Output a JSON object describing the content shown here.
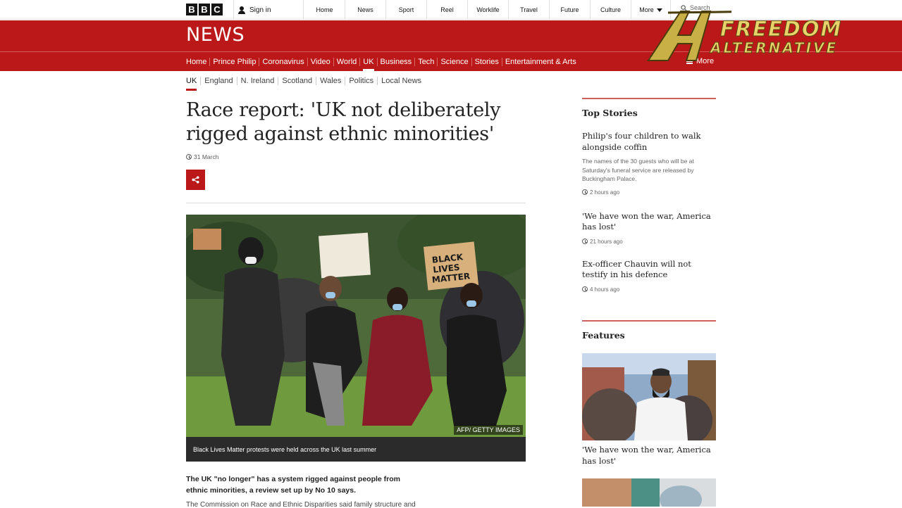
{
  "topbar": {
    "logo_letters": [
      "B",
      "B",
      "C"
    ],
    "signin_label": "Sign in",
    "nav": [
      "Home",
      "News",
      "Sport",
      "Reel",
      "Worklife",
      "Travel",
      "Future",
      "Culture"
    ],
    "more_label": "More",
    "search_placeholder": "Search"
  },
  "newsbar": {
    "title": "NEWS",
    "nav": [
      "Home",
      "Prince Philip",
      "Coronavirus",
      "Video",
      "World",
      "UK",
      "Business",
      "Tech",
      "Science",
      "Stories",
      "Entertainment & Arts"
    ],
    "active_nav": "UK",
    "more_label": "More"
  },
  "watermark": {
    "line1": "FREEDOM",
    "line2": "ALTERNATIVE"
  },
  "subnav": {
    "items": [
      "UK",
      "England",
      "N. Ireland",
      "Scotland",
      "Wales",
      "Politics",
      "Local News"
    ],
    "active": "UK"
  },
  "article": {
    "headline": "Race report: 'UK not deliberately rigged against ethnic minorities'",
    "date": "31 March",
    "image_credit": "AFP/ GETTY IMAGES",
    "image_caption": "Black Lives Matter protests were held across the UK last summer",
    "sign_text": "BLACK LIVES MATTER",
    "lead": "The UK \"no longer\" has a system rigged against people from ethnic minorities, a review set up by No 10 says.",
    "second_paragraph": "The Commission on Race and Ethnic Disparities said family structure and"
  },
  "sidebar": {
    "top_stories_heading": "Top Stories",
    "stories": [
      {
        "title": "Philip's four children to walk alongside coffin",
        "summary": "The names of the 30 guests who will be at Saturday's funeral service are released by Buckingham Palace.",
        "time": "2 hours ago"
      },
      {
        "title": "'We have won the war, America has lost'",
        "summary": "",
        "time": "21 hours ago"
      },
      {
        "title": "Ex-officer Chauvin will not testify in his defence",
        "summary": "",
        "time": "4 hours ago"
      }
    ],
    "features_heading": "Features",
    "feature_title": "'We have won the war, America has lost'"
  },
  "colors": {
    "bbc_red": "#bb1919",
    "text_dark": "#222222",
    "watermark_gold": "#e8d36a"
  }
}
